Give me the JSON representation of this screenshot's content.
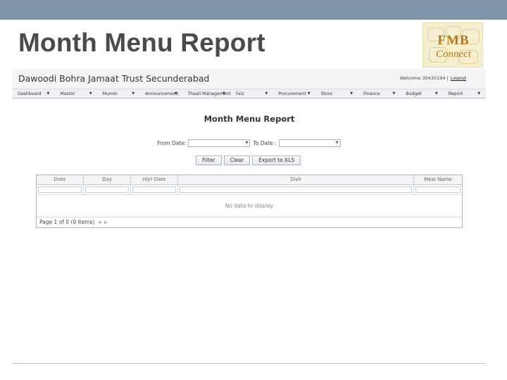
{
  "slide": {
    "title": "Month Menu Report"
  },
  "logo": {
    "line1": "FMB",
    "line2": "Connect"
  },
  "app": {
    "title": "Dawoodi Bohra Jamaat Trust Secunderabad",
    "welcome": "Welcome 30430194 |",
    "logout": "Logout"
  },
  "nav": {
    "items": [
      {
        "label": "Dashboard"
      },
      {
        "label": "Master"
      },
      {
        "label": "Mumin"
      },
      {
        "label": "Announcement"
      },
      {
        "label": "Thaali Management"
      },
      {
        "label": "Faiz"
      },
      {
        "label": "Procurement"
      },
      {
        "label": "Store"
      },
      {
        "label": "Finance"
      },
      {
        "label": "Budget"
      },
      {
        "label": "Report"
      }
    ]
  },
  "report": {
    "title": "Month Menu Report",
    "from_label": "From Date:",
    "to_label": "To Date :",
    "from_value": "",
    "to_value": "",
    "buttons": {
      "filter": "Filter",
      "clear": "Clear",
      "export": "Export to XLS"
    }
  },
  "grid": {
    "columns": [
      "Date",
      "Day",
      "Hijri Date",
      "Dish",
      "Meal Name"
    ],
    "empty_text": "No data to display",
    "pager_text": "Page 1 of 0 (0 items)"
  },
  "colors": {
    "top_band": "#7d94a8",
    "title_text": "#4a4a4a",
    "logo_gold": "#b07a1e"
  },
  "icons": {
    "nav_caret": "caret-down-icon",
    "pager_prev": "pager-prev-icon",
    "pager_next": "pager-next-icon"
  }
}
